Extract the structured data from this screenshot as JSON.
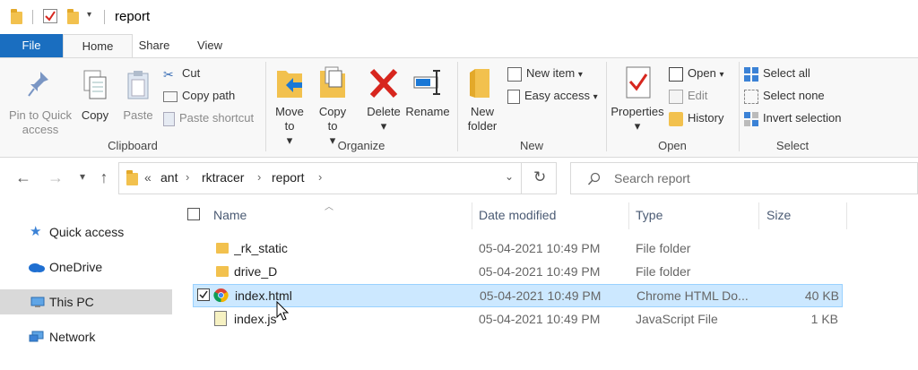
{
  "window": {
    "title": "report"
  },
  "ribbon_tabs": [
    "File",
    "Home",
    "Share",
    "View"
  ],
  "clipboard": {
    "pin": "Pin to Quick access",
    "copy": "Copy",
    "paste": "Paste",
    "cut": "Cut",
    "copy_path": "Copy path",
    "paste_shortcut": "Paste shortcut",
    "label": "Clipboard"
  },
  "organize": {
    "move_to": "Move to",
    "copy_to": "Copy to",
    "delete": "Delete",
    "rename": "Rename",
    "label": "Organize"
  },
  "new_group": {
    "new_folder": "New folder",
    "new_item": "New item",
    "easy_access": "Easy access",
    "label": "New"
  },
  "open_group": {
    "properties": "Properties",
    "open": "Open",
    "edit": "Edit",
    "history": "History",
    "label": "Open"
  },
  "select_group": {
    "select_all": "Select all",
    "select_none": "Select none",
    "invert": "Invert selection",
    "label": "Select"
  },
  "breadcrumb": {
    "overflow": "«",
    "items": [
      "ant",
      "rktracer",
      "report"
    ]
  },
  "search": {
    "placeholder": "Search report"
  },
  "nav_pane": [
    "Quick access",
    "OneDrive",
    "This PC",
    "Network"
  ],
  "columns": {
    "name": "Name",
    "date": "Date modified",
    "type": "Type",
    "size": "Size"
  },
  "files": [
    {
      "name": "_rk_static",
      "date": "05-04-2021 10:49 PM",
      "type": "File folder",
      "size": ""
    },
    {
      "name": "drive_D",
      "date": "05-04-2021 10:49 PM",
      "type": "File folder",
      "size": ""
    },
    {
      "name": "index.html",
      "date": "05-04-2021 10:49 PM",
      "type": "Chrome HTML Do...",
      "size": "40 KB"
    },
    {
      "name": "index.js",
      "date": "05-04-2021 10:49 PM",
      "type": "JavaScript File",
      "size": "1 KB"
    }
  ],
  "colors": {
    "file_tab": "#1a6ec0",
    "selection": "#cce8ff",
    "folder": "#f2c14e",
    "delete": "#d7261e"
  }
}
